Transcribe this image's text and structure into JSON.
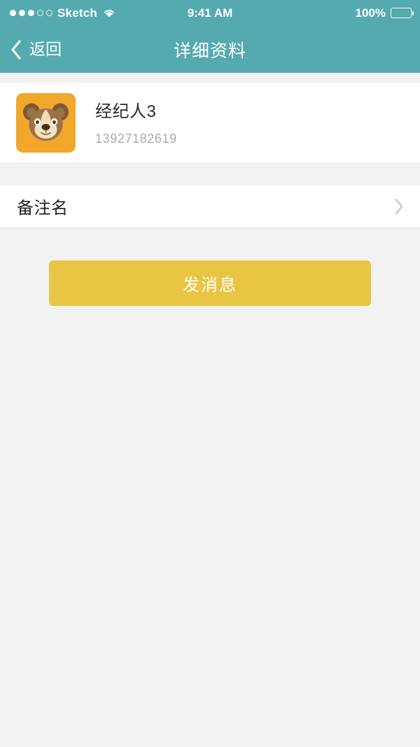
{
  "status_bar": {
    "signal_dots_filled": 3,
    "signal_dots_empty": 2,
    "carrier": "Sketch",
    "wifi_icon": "wifi-icon",
    "time": "9:41 AM",
    "battery_percent": "100%",
    "battery_icon": "battery-full-icon"
  },
  "nav_bar": {
    "back_icon": "chevron-left-icon",
    "back_label": "返回",
    "title": "详细资料"
  },
  "profile": {
    "avatar_icon": "bear-avatar-icon",
    "name": "经纪人3",
    "phone": "13927182619"
  },
  "settings": {
    "rows": [
      {
        "label": "备注名",
        "value": "",
        "chevron_icon": "chevron-right-icon"
      }
    ]
  },
  "actions": {
    "send_message_label": "发消息"
  },
  "colors": {
    "header_teal": "#55aab0",
    "button_gold": "#e9c544",
    "avatar_orange": "#f0a72a",
    "page_background": "#f2f2f2",
    "card_background": "#ffffff",
    "name_text": "#2b2b2b",
    "phone_text": "#a9a9a9",
    "chevron_gray": "#c9c9c9"
  }
}
